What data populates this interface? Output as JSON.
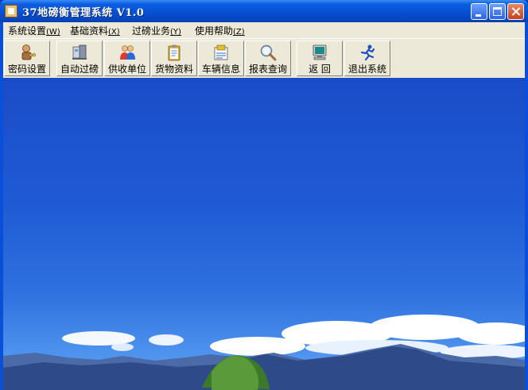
{
  "window": {
    "title": "37地磅衡管理系统 V1.0"
  },
  "menu": [
    {
      "label": "系统设置",
      "accel": "(W)"
    },
    {
      "label": "基础资料",
      "accel": "(X)"
    },
    {
      "label": "过磅业务",
      "accel": "(Y)"
    },
    {
      "label": "使用帮助",
      "accel": "(Z)"
    }
  ],
  "toolbar": [
    {
      "label": "密码设置",
      "icon": "key-person-icon"
    },
    {
      "label": "自动过磅",
      "icon": "scale-icon"
    },
    {
      "label": "供收单位",
      "icon": "users-icon"
    },
    {
      "label": "货物资料",
      "icon": "clipboard-icon"
    },
    {
      "label": "车辆信息",
      "icon": "vehicle-doc-icon"
    },
    {
      "label": "报表查询",
      "icon": "magnifier-icon"
    },
    {
      "label": "返 回",
      "icon": "monitor-icon"
    },
    {
      "label": "退出系统",
      "icon": "running-man-icon"
    }
  ],
  "colors": {
    "titlebar": "#0753d6",
    "chrome": "#ece9d8",
    "sky": "#1f5ad4"
  }
}
